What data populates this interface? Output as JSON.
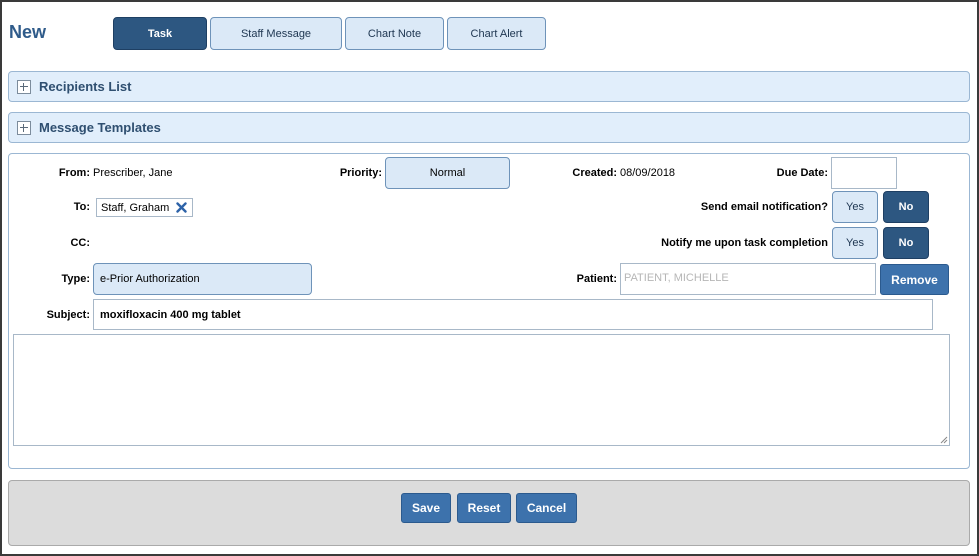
{
  "header": {
    "title": "New"
  },
  "tabs": [
    {
      "label": "Task",
      "active": true
    },
    {
      "label": "Staff Message",
      "active": false
    },
    {
      "label": "Chart Note",
      "active": false
    },
    {
      "label": "Chart Alert",
      "active": false
    }
  ],
  "sections": {
    "recipients": "Recipients List",
    "templates": "Message Templates"
  },
  "form": {
    "from_label": "From:",
    "from_value": "Prescriber, Jane",
    "priority_label": "Priority:",
    "priority_value": "Normal",
    "created_label": "Created:",
    "created_value": "08/09/2018",
    "due_label": "Due Date:",
    "due_value": "",
    "to_label": "To:",
    "to_recipient": "Staff, Graham",
    "email_label": "Send email notification?",
    "notify_label": "Notify me upon task completion",
    "yes_label": "Yes",
    "no_label": "No",
    "cc_label": "CC:",
    "type_label": "Type:",
    "type_value": "e-Prior Authorization",
    "patient_label": "Patient:",
    "patient_placeholder": "PATIENT, MICHELLE",
    "remove_label": "Remove",
    "subject_label": "Subject:",
    "subject_value": "moxifloxacin 400 mg tablet",
    "body_value": ""
  },
  "footer": {
    "save": "Save",
    "reset": "Reset",
    "cancel": "Cancel"
  },
  "colors": {
    "accent": "#2d5781",
    "light_blue": "#dbe9f7",
    "button_blue": "#3d72ac"
  },
  "icons": {
    "remove_recipient": "close-x-icon",
    "expand": "plus-box-icon"
  }
}
